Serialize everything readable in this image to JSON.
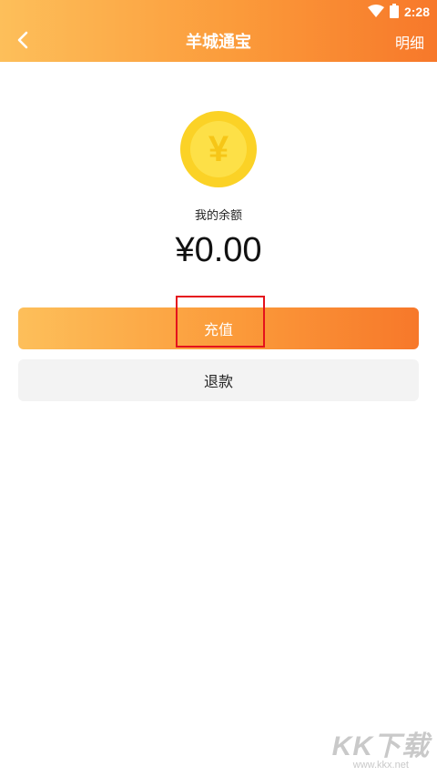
{
  "status_bar": {
    "time": "2:28",
    "icons": [
      "wifi-icon",
      "battery-icon"
    ]
  },
  "header": {
    "title": "羊城通宝",
    "right_action": "明细",
    "back_icon": "chevron-left-icon"
  },
  "balance": {
    "coin_icon": "yen-coin-icon",
    "coin_symbol": "¥",
    "label": "我的余额",
    "amount": "¥0.00"
  },
  "actions": {
    "recharge_label": "充值",
    "refund_label": "退款"
  },
  "watermark": {
    "main": "KK下载",
    "sub": "www.kkx.net"
  },
  "colors": {
    "accent_start": "#fdbf5a",
    "accent_end": "#f7782a",
    "coin": "#fbd226",
    "highlight": "#e5121c"
  }
}
